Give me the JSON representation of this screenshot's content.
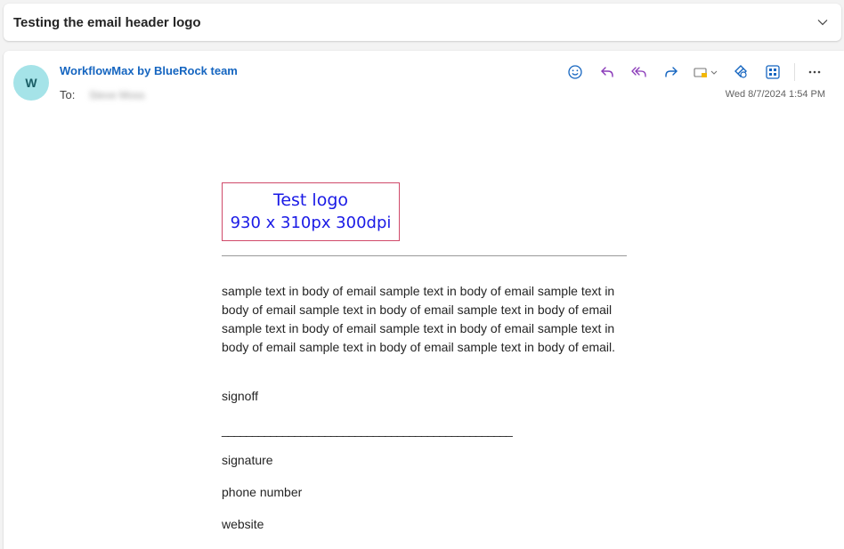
{
  "subject": {
    "title": "Testing the email header logo",
    "expand_icon": "chevron-down-icon"
  },
  "message": {
    "avatar_initial": "W",
    "avatar_color": "#a5e3e8",
    "sender": "WorkflowMax by BlueRock team",
    "to_label": "To:",
    "recipient": "Steve Moss",
    "timestamp": "Wed 8/7/2024 1:54 PM",
    "accent_color": "#1565c0",
    "toolbar_icons": [
      "emoji-reaction-icon",
      "reply-icon",
      "reply-all-icon",
      "forward-icon",
      "message-actions-icon",
      "loop-icon",
      "apps-icon",
      "more-options-icon"
    ]
  },
  "email_body": {
    "logo_line1": "Test logo",
    "logo_line2": "930 x 310px 300dpi",
    "paragraph": "sample text in body of email sample text in body of email sample text in body of email sample text in body of email sample text in body of email sample text in body of email sample text in body of email sample text in body of email sample text in body of email sample text in body of email.",
    "signoff": "signoff",
    "signature_line": "________________________________________________",
    "signature": "signature",
    "phone": "phone number",
    "website": "website"
  }
}
